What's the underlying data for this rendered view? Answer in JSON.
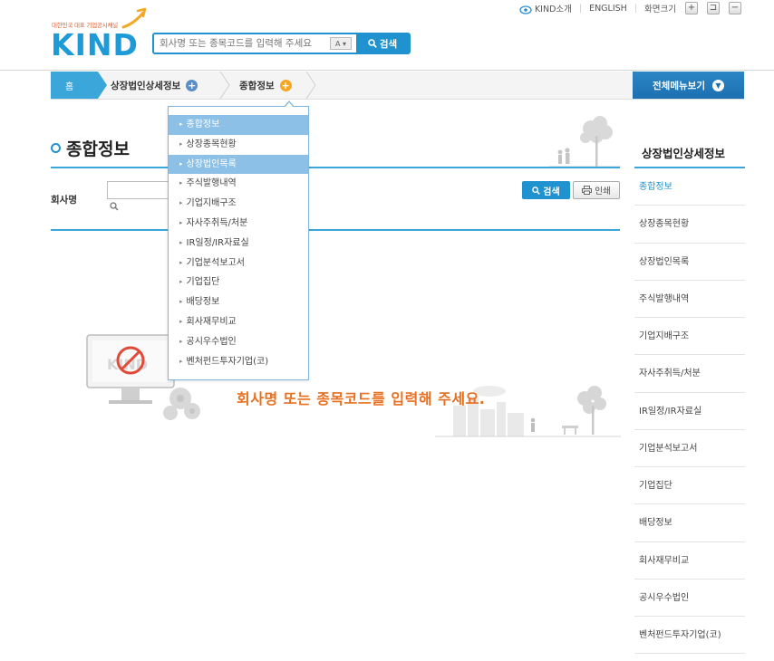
{
  "util": {
    "kind_intro": "KIND소개",
    "english": "ENGLISH",
    "zoom_label": "화면크기",
    "zoom_in": "+",
    "zoom_reset": "⊐",
    "zoom_out": "−"
  },
  "logo": {
    "tagline": "대한민국 대표 기업공시채널",
    "word": "KIND"
  },
  "search": {
    "placeholder": "회사명 또는 종목코드를 입력해 주세요",
    "autocomplete": "A ▾",
    "button": "검색"
  },
  "breadcrumb": {
    "home": "홈",
    "level1": "상장법인상세정보",
    "level2": "종합정보",
    "all_menu": "전체메뉴보기",
    "colors": {
      "plus_gray": "#5b8fc4",
      "plus_orange": "#f5a623"
    }
  },
  "main": {
    "title": "종합정보",
    "company_label": "회사명",
    "search_button": "검색",
    "print_button": "인쇄",
    "prompt": "회사명 또는 종목코드를 입력해 주세요."
  },
  "dropdown": {
    "items": [
      "종합정보",
      "상장종목현황",
      "상장법인목록",
      "주식발행내역",
      "기업지배구조",
      "자사주취득/처분",
      "IR일정/IR자료실",
      "기업분석보고서",
      "기업집단",
      "배당정보",
      "회사재무비교",
      "공시우수법인",
      "벤처펀드투자기업(코)"
    ]
  },
  "sidebar": {
    "title": "상장법인상세정보",
    "items": [
      "종합정보",
      "상장종목현황",
      "상장법인목록",
      "주식발행내역",
      "기업지배구조",
      "자사주취득/처분",
      "IR일정/IR자료실",
      "기업분석보고서",
      "기업집단",
      "배당정보",
      "회사재무비교",
      "공시우수법인",
      "벤처펀드투자기업(코)"
    ]
  },
  "colors": {
    "accent": "#1f92cf",
    "prompt": "#e86f1f"
  }
}
